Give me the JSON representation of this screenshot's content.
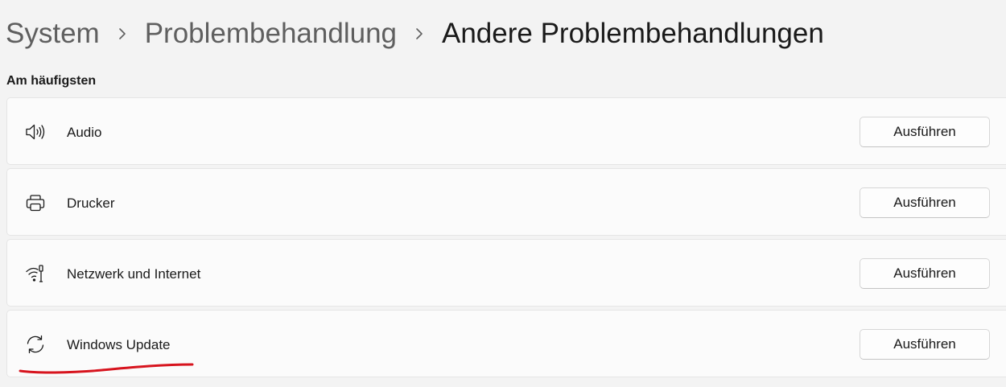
{
  "breadcrumb": {
    "items": [
      "System",
      "Problembehandlung",
      "Andere Problembehandlungen"
    ]
  },
  "section": {
    "title": "Am häufigsten"
  },
  "troubleshooters": [
    {
      "label": "Audio",
      "icon": "speaker-icon",
      "button": "Ausführen"
    },
    {
      "label": "Drucker",
      "icon": "printer-icon",
      "button": "Ausführen"
    },
    {
      "label": "Netzwerk und Internet",
      "icon": "network-icon",
      "button": "Ausführen"
    },
    {
      "label": "Windows Update",
      "icon": "sync-icon",
      "button": "Ausführen"
    }
  ],
  "annotation": {
    "color": "#d7141e"
  }
}
